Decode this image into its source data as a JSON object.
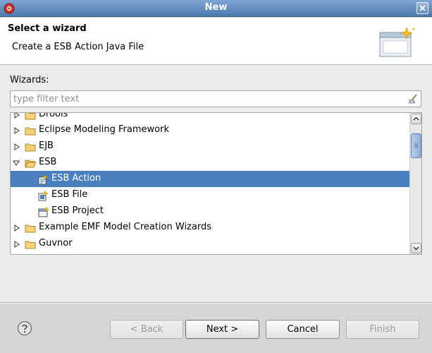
{
  "window": {
    "title": "New"
  },
  "header": {
    "title": "Select a wizard",
    "description": "Create a ESB Action Java File"
  },
  "wizards_label": "Wizards:",
  "filter": {
    "placeholder": "type filter text",
    "value": ""
  },
  "tree": {
    "items": [
      {
        "label": "Drools",
        "level": 0,
        "expanded": false,
        "icon": "folder-icon"
      },
      {
        "label": "Eclipse Modeling Framework",
        "level": 0,
        "expanded": false,
        "icon": "folder-icon"
      },
      {
        "label": "EJB",
        "level": 0,
        "expanded": false,
        "icon": "folder-icon"
      },
      {
        "label": "ESB",
        "level": 0,
        "expanded": true,
        "icon": "folder-open-icon"
      },
      {
        "label": "ESB Action",
        "level": 1,
        "selected": true,
        "icon": "esb-action-icon"
      },
      {
        "label": "ESB File",
        "level": 1,
        "icon": "esb-file-icon"
      },
      {
        "label": "ESB Project",
        "level": 1,
        "icon": "esb-project-icon"
      },
      {
        "label": "Example EMF Model Creation Wizards",
        "level": 0,
        "expanded": false,
        "icon": "folder-icon"
      },
      {
        "label": "Guvnor",
        "level": 0,
        "expanded": false,
        "icon": "folder-icon"
      }
    ]
  },
  "buttons": {
    "back": "< Back",
    "next": "Next >",
    "cancel": "Cancel",
    "finish": "Finish"
  },
  "colors": {
    "selection": "#4a80bf",
    "titlebar": "#5b86bb"
  }
}
